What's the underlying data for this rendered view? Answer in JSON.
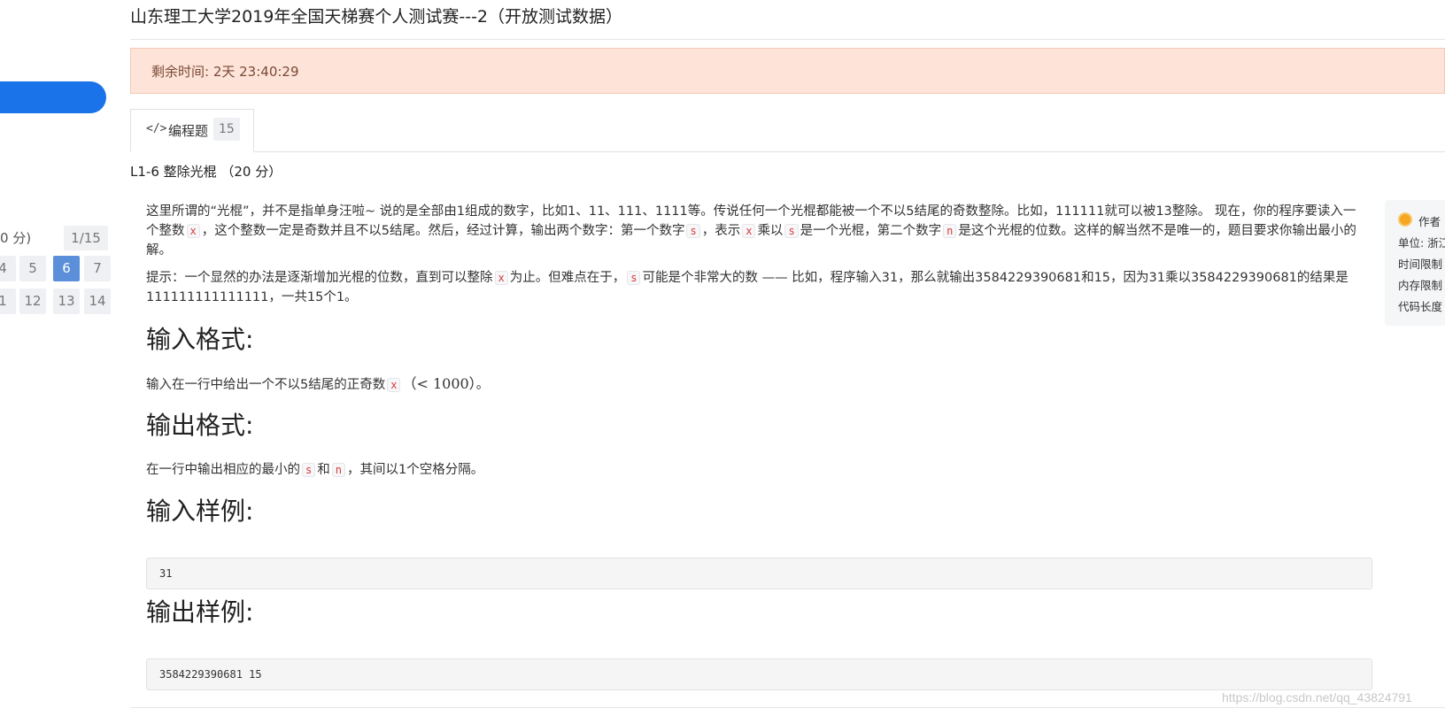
{
  "header": {
    "title": "山东理工大学2019年全国天梯赛个人测试赛---2（开放测试数据）",
    "timer_label": "剩余时间: 2天 23:40:29"
  },
  "sidebar": {
    "score_fragment": "0 分)",
    "progress": "1/15",
    "question_numbers_row1": [
      "4",
      "5",
      "6",
      "7"
    ],
    "question_numbers_row2": [
      "1",
      "12",
      "13",
      "14"
    ],
    "active_question": "6"
  },
  "tab": {
    "icon": "code-icon",
    "icon_glyph": "</>",
    "label": "编程题",
    "count": "15"
  },
  "problem": {
    "title": "L1-6 整除光棍  （20 分）",
    "p1_a": "这里所谓的“光棍”，并不是指单身汪啦~ 说的是全部由1组成的数字，比如1、11、111、1111等。传说任何一个光棍都能被一个不以5结尾的奇数整除。比如，111111就可以被13整除。 现在，你的程序要读入一个整数",
    "p1_b": "，这个整数一定是奇数并且不以5结尾。然后，经过计算，输出两个数字：第一个数字",
    "p1_c": "，表示",
    "p1_d": "乘以",
    "p1_e": "是一个光棍，第二个数字",
    "p1_f": "是这个光棍的位数。这样的解当然不是唯一的，题目要求你输出最小的解。",
    "p2_a": "提示：一个显然的办法是逐渐增加光棍的位数，直到可以整除",
    "p2_b": "为止。但难点在于，",
    "p2_c": "可能是个非常大的数 —— 比如，程序输入31，那么就输出3584229390681和15，因为31乘以3584229390681的结果是111111111111111，一共15个1。",
    "var_x": "x",
    "var_s": "s",
    "var_n": "n",
    "input_format_heading": "输入格式:",
    "input_format_a": "输入在一行中给出一个不以5结尾的正奇数",
    "input_format_math": "（< 1000）",
    "input_format_b": "。",
    "output_format_heading": "输出格式:",
    "output_format_a": "在一行中输出相应的最小的",
    "output_format_b": "和",
    "output_format_c": "，其间以1个空格分隔。",
    "sample_input_heading": "输入样例:",
    "sample_input": "31",
    "sample_output_heading": "输出样例:",
    "sample_output": "3584229390681 15"
  },
  "side_card": {
    "author": "作者",
    "unit": "单位: 浙江",
    "time_limit": "时间限制",
    "memory_limit": "内存限制",
    "code_length": "代码长度"
  },
  "watermark": "https://blog.csdn.net/qq_43824791"
}
